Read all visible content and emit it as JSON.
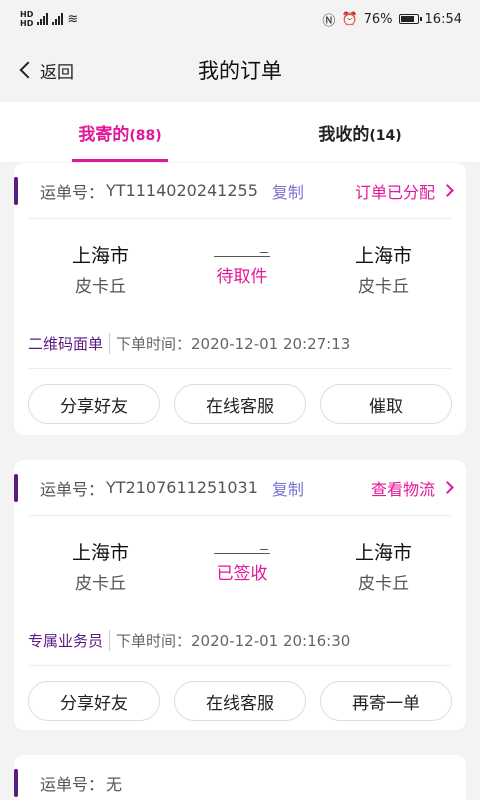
{
  "statusbar": {
    "left": "HD 4G 4G",
    "battery": "76%",
    "time": "16:54"
  },
  "header": {
    "back_label": "返回",
    "title": "我的订单"
  },
  "tabs": [
    {
      "label": "我寄的",
      "count": "(88)"
    },
    {
      "label": "我收的",
      "count": "(14)"
    }
  ],
  "orders": [
    {
      "waybill_label": "运单号：",
      "waybill_no": "YT1114020241255",
      "copy_label": "复制",
      "status": "订单已分配",
      "from_city": "上海市",
      "from_area": "皮卡丘",
      "state": "待取件",
      "to_city": "上海市",
      "to_area": "皮卡丘",
      "tag": "二维码面单",
      "time": "下单时间：2020-12-01 20:27:13",
      "actions": [
        "分享好友",
        "在线客服",
        "催取"
      ]
    },
    {
      "waybill_label": "运单号：",
      "waybill_no": "YT2107611251031",
      "copy_label": "复制",
      "status": "查看物流",
      "from_city": "上海市",
      "from_area": "皮卡丘",
      "state": "已签收",
      "to_city": "上海市",
      "to_area": "皮卡丘",
      "tag": "专属业务员",
      "time": "下单时间：2020-12-01 20:16:30",
      "actions": [
        "分享好友",
        "在线客服",
        "再寄一单"
      ]
    },
    {
      "waybill_label": "运单号：",
      "waybill_no": "无"
    }
  ]
}
